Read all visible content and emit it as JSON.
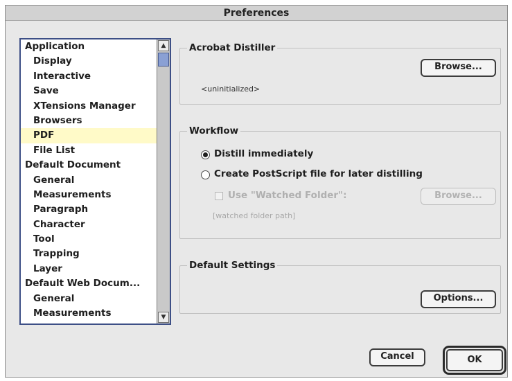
{
  "window": {
    "title": "Preferences"
  },
  "list": {
    "items": [
      {
        "label": "Application",
        "level": 0
      },
      {
        "label": "Display",
        "level": 1
      },
      {
        "label": "Interactive",
        "level": 1
      },
      {
        "label": "Save",
        "level": 1
      },
      {
        "label": "XTensions Manager",
        "level": 1
      },
      {
        "label": "Browsers",
        "level": 1
      },
      {
        "label": "PDF",
        "level": 1,
        "selected": true
      },
      {
        "label": "File List",
        "level": 1
      },
      {
        "label": "Default Document",
        "level": 0
      },
      {
        "label": "General",
        "level": 1
      },
      {
        "label": "Measurements",
        "level": 1
      },
      {
        "label": "Paragraph",
        "level": 1
      },
      {
        "label": "Character",
        "level": 1
      },
      {
        "label": "Tool",
        "level": 1
      },
      {
        "label": "Trapping",
        "level": 1
      },
      {
        "label": "Layer",
        "level": 1
      },
      {
        "label": "Default Web Docum...",
        "level": 0
      },
      {
        "label": "General",
        "level": 1
      },
      {
        "label": "Measurements",
        "level": 1
      }
    ],
    "scroll_up_icon": "▲",
    "scroll_down_icon": "▼"
  },
  "distiller": {
    "label": "Acrobat Distiller",
    "browse_label": "Browse...",
    "path_text": "<uninitialized>"
  },
  "workflow": {
    "label": "Workflow",
    "option_distill": "Distill immediately",
    "option_postscript": "Create PostScript file for later distilling",
    "selected": "distill",
    "watched_label": "Use \"Watched Folder\":",
    "watched_browse_label": "Browse...",
    "watched_path": "[watched folder path]"
  },
  "defaults": {
    "label": "Default Settings",
    "options_label": "Options..."
  },
  "footer": {
    "cancel_label": "Cancel",
    "ok_label": "OK"
  },
  "colors": {
    "selection": "#fffac8",
    "list_border": "#3d4f86",
    "scroll_thumb": "#8aa0d4"
  }
}
